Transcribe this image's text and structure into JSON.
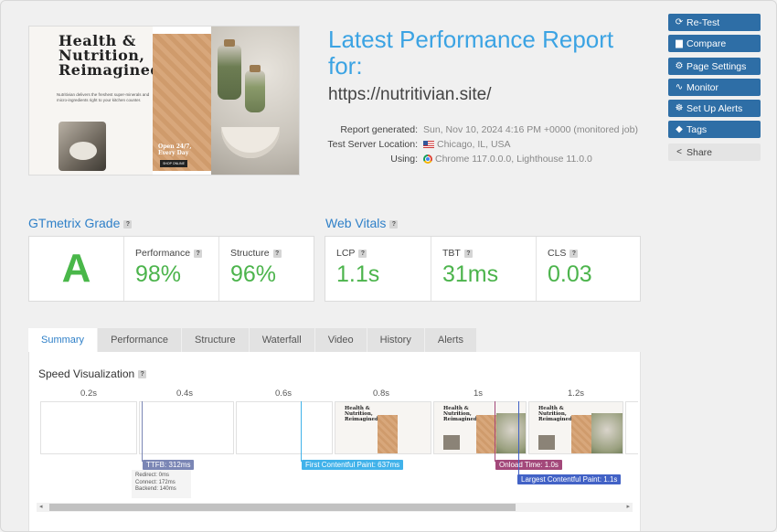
{
  "screenshot": {
    "headline": "Health & Nutrition, Reimagined",
    "blurb": "Nutritivian delivers the freshest super-minerals and micro-ingredients right to your kitchen counter.",
    "promo": "Open 24/7, Every Day",
    "cta": "SHOP ONLINE"
  },
  "report": {
    "title": "Latest Performance Report for:",
    "url": "https://nutritivian.site/",
    "generated_label": "Report generated:",
    "generated_value": "Sun, Nov 10, 2024 4:16 PM +0000 (monitored job)",
    "location_label": "Test Server Location:",
    "location_value": "Chicago, IL, USA",
    "using_label": "Using:",
    "using_value": "Chrome 117.0.0.0, Lighthouse 11.0.0"
  },
  "actions": {
    "retest": "Re-Test",
    "compare": "Compare",
    "page_settings": "Page Settings",
    "monitor": "Monitor",
    "alerts": "Set Up Alerts",
    "tags": "Tags",
    "share": "Share"
  },
  "grade": {
    "heading": "GTmetrix Grade",
    "letter": "A",
    "performance_label": "Performance",
    "performance_value": "98%",
    "structure_label": "Structure",
    "structure_value": "96%"
  },
  "vitals": {
    "heading": "Web Vitals",
    "lcp_label": "LCP",
    "lcp_value": "1.1s",
    "tbt_label": "TBT",
    "tbt_value": "31ms",
    "cls_label": "CLS",
    "cls_value": "0.03"
  },
  "help_mark": "?",
  "tabs": [
    "Summary",
    "Performance",
    "Structure",
    "Waterfall",
    "Video",
    "History",
    "Alerts"
  ],
  "speed": {
    "heading": "Speed Visualization",
    "ticks": [
      "0.2s",
      "0.4s",
      "0.6s",
      "0.8s",
      "1s",
      "1.2s"
    ],
    "thumb_title_1": "Health & Nutrition, Reimagined",
    "thumb_title_2": "Health & Nutrition, Reimagined",
    "thumb_title_3": "Health & Nutrition, Reimagined",
    "ttfb": "TTFB: 312ms",
    "redirect": "Redirect: 0ms",
    "connect": "Connect: 172ms",
    "backend": "Backend: 140ms",
    "fcp": "First Contentful Paint: 637ms",
    "onload": "Onload Time: 1.0s",
    "lcp": "Largest Contentful Paint: 1.1s"
  },
  "colors": {
    "accent": "#3ba3e3",
    "button": "#2e6ea6",
    "grade_green": "#49b749",
    "ttfb": "#7b86b5",
    "fcp": "#41b2ea",
    "onload": "#a3487a",
    "lcp": "#4262c6"
  }
}
